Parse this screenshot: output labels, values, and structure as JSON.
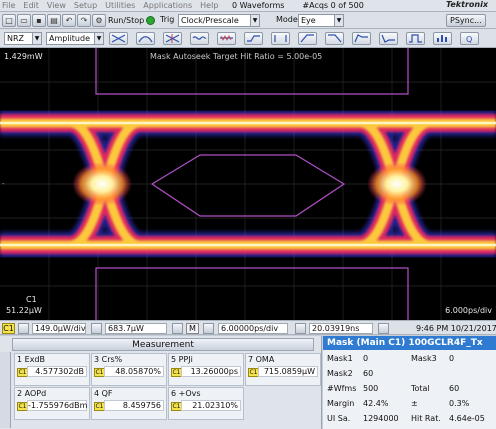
{
  "menubar": {
    "items": [
      "File",
      "Edit",
      "View",
      "Setup",
      "Utilities",
      "Applications",
      "Help"
    ],
    "waveforms": "0 Waveforms",
    "acqs": "#Acqs  0 of 500",
    "brand": "Tektronix"
  },
  "toolbar1": {
    "runstop": "Run/Stop",
    "trig_label": "Trig",
    "trig_value": "Clock/Prescale",
    "mode_label": "Mode",
    "mode_value": "Eye",
    "psync": "PSync..."
  },
  "toolbar2": {
    "pattern_value": "NRZ",
    "measure_value": "Amplitude"
  },
  "display": {
    "top_left": "1.429mW",
    "mask_title": "Mask Autoseek Target Hit Ratio = 5.00e-05",
    "channel": "C1",
    "bottom_left": "51.22μW",
    "bottom_right": "6.000ps/div",
    "colors": {
      "hot": "#ffffff",
      "warm": "#ffe14a",
      "mid": "#ff2a6a",
      "cool": "#4a4dff",
      "mask": "#b050c8"
    }
  },
  "readout": {
    "ch_chip": "C1",
    "vert_div": "149.0μW/div",
    "offset": "683.7μW",
    "m_chip": "M",
    "horiz_div": "6.00000ps/div",
    "position": "20.03919ns",
    "datetime": "9:46 PM 10/21/2017"
  },
  "measurement": {
    "title": "Measurement",
    "cells": [
      {
        "name": "1 ExdB",
        "value": "4.577302dB"
      },
      {
        "name": "3 Crs%",
        "value": "48.05870%"
      },
      {
        "name": "5 PPJi",
        "value": "13.26000ps"
      },
      {
        "name": "7 OMA",
        "value": "715.0859μW"
      },
      {
        "name": "2 AOPd",
        "value": "-1.755976dBm"
      },
      {
        "name": "4 QF",
        "value": "8.459756"
      },
      {
        "name": "6 +Ovs",
        "value": "21.02310%"
      }
    ]
  },
  "mask": {
    "title": "Mask (Main  C1)  100GCLR4F_Tx",
    "rows": [
      {
        "k1": "Mask1",
        "v1": "0",
        "k2": "Mask3",
        "v2": "0"
      },
      {
        "k1": "Mask2",
        "v1": "60",
        "k2": "",
        "v2": ""
      },
      {
        "k1": "#Wfms",
        "v1": "500",
        "k2": "Total",
        "v2": "60"
      },
      {
        "k1": "Margin",
        "v1": "42.4%",
        "k2": "±",
        "v2": "0.3%"
      },
      {
        "k1": "UI Sa.",
        "v1": "1294000",
        "k2": "Hit Rat.",
        "v2": "4.64e-05"
      }
    ]
  }
}
